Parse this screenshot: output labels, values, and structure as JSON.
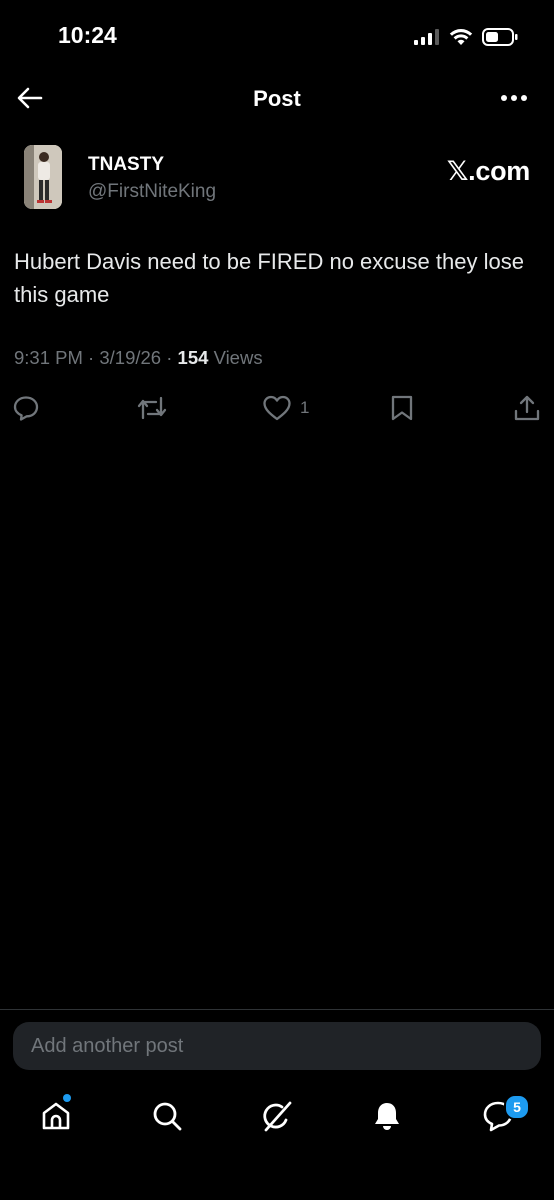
{
  "status_bar": {
    "time": "10:24"
  },
  "header": {
    "title": "Post"
  },
  "author": {
    "display_name": "TNASTY",
    "handle": "@FirstNiteKing"
  },
  "brand": {
    "label": "𝕏.com"
  },
  "post": {
    "text": "Hubert Davis need to be FIRED no excuse they lose this game",
    "time": "9:31 PM",
    "date": "3/19/26",
    "views_count": "154",
    "views_label": "Views"
  },
  "actions": {
    "reply_icon": "reply-icon",
    "repost_icon": "repost-icon",
    "like_icon": "heart-icon",
    "like_count": "1",
    "bookmark_icon": "bookmark-icon",
    "share_icon": "share-icon"
  },
  "composer": {
    "placeholder": "Add another post"
  },
  "tab_bar": {
    "items": [
      "home-icon",
      "search-icon",
      "grok-icon",
      "notifications-icon",
      "messages-icon"
    ],
    "messages_badge": "5"
  },
  "colors": {
    "accent": "#1d9bf0",
    "muted": "#71767b",
    "background": "#000000",
    "text": "#e7e9ea"
  }
}
